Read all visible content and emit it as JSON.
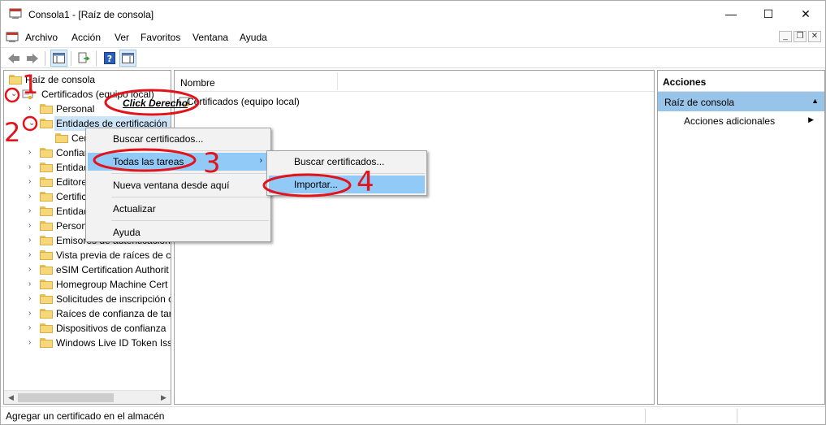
{
  "window": {
    "title": "Consola1 - [Raíz de consola]",
    "min_glyph": "—",
    "max_glyph": "☐",
    "close_glyph": "✕"
  },
  "menubar": {
    "items": [
      "Archivo",
      "Acción",
      "Ver",
      "Favoritos",
      "Ventana",
      "Ayuda"
    ],
    "mdi_min": "_",
    "mdi_restore": "❐",
    "mdi_close": "✕"
  },
  "toolbar": {
    "buttons": [
      "back-arrow-icon",
      "forward-arrow-icon",
      "show-hide-tree-icon",
      "export-list-icon",
      "help-icon",
      "show-hide-action-pane-icon"
    ]
  },
  "tree": {
    "root": "Raíz de consola",
    "certificates": "Certificados (equipo local)",
    "items": [
      "Personal",
      "Entidades de certificación r",
      "Certificados",
      "Confianza empresarial",
      "Entidades de certificación intermedias",
      "Editores de confianza",
      "Certificados en los que no se confía",
      "Entidades de certificación raíz de terceros",
      "Personas de confianza",
      "Emisores de autenticación de clientes",
      "Vista previa de raíces de co",
      "eSIM Certification Authorit",
      "Homegroup Machine Cert",
      "Solicitudes de inscripción c",
      "Raíces de confianza de tarj",
      "Dispositivos de confianza",
      "Windows Live ID Token Issu"
    ]
  },
  "list": {
    "column_name": "Nombre",
    "rows": [
      "Certificados (equipo local)"
    ]
  },
  "actions": {
    "title": "Acciones",
    "section": "Raíz de consola",
    "more": "Acciones adicionales"
  },
  "statusbar": {
    "text": "Agregar un certificado en el almacén"
  },
  "context_menu": {
    "items": [
      "Buscar certificados...",
      "Todas las tareas",
      "Nueva ventana desde aquí",
      "Actualizar",
      "Ayuda"
    ],
    "submenu_glyph": "›"
  },
  "submenu": {
    "items": [
      "Buscar certificados...",
      "Importar..."
    ]
  },
  "annotations": {
    "n1": "1",
    "n2": "2",
    "n3": "3",
    "n4": "4",
    "click_label": "Click Derecho"
  },
  "colors": {
    "selection": "#cce4f7",
    "menu_highlight": "#91c9f7",
    "actions_header": "#99c4ea",
    "annotation_red": "#e2131a"
  }
}
